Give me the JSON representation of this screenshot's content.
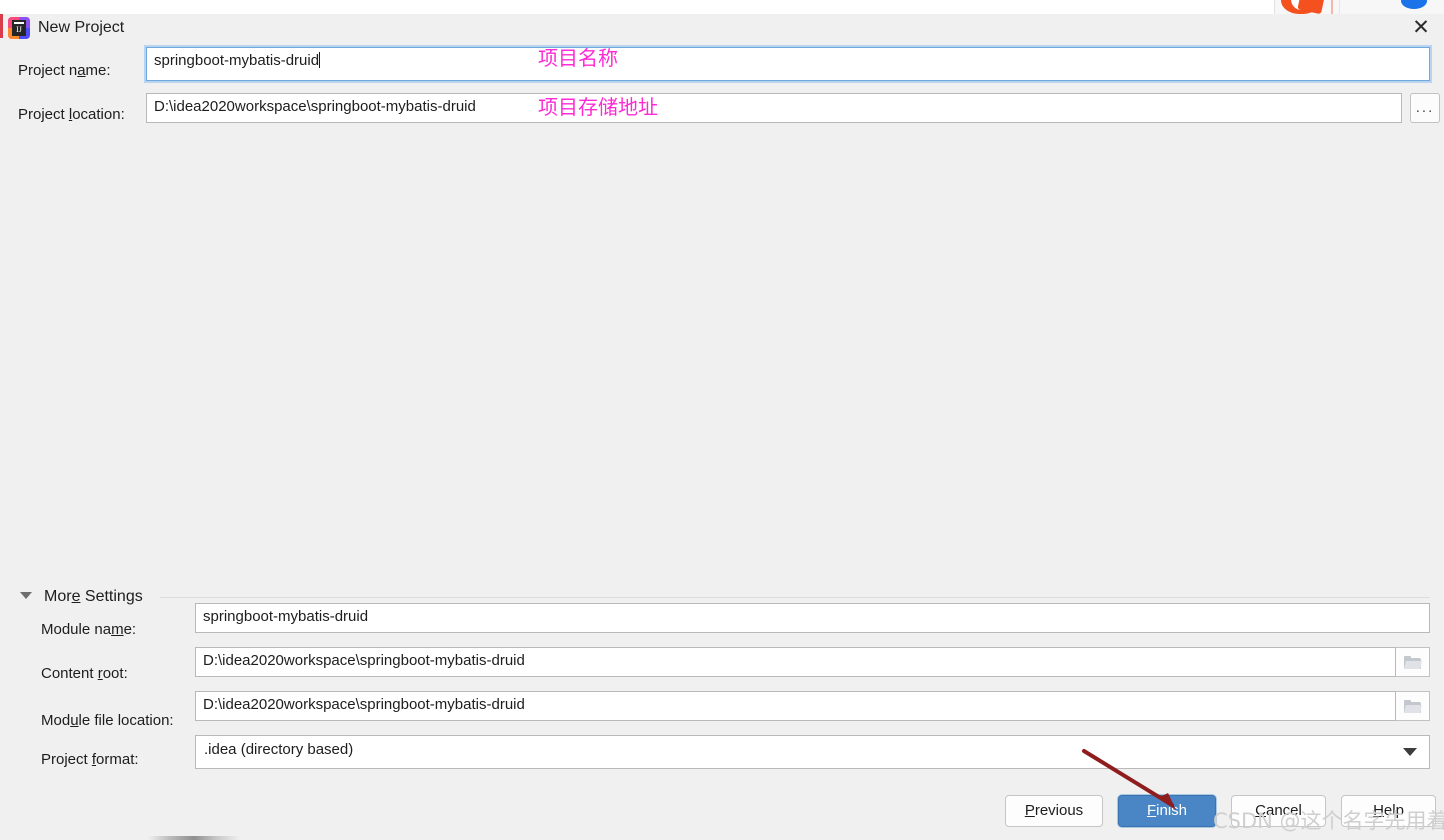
{
  "window": {
    "title": "New Project",
    "logo_icon": "intellij-idea-logo",
    "close_icon": "close-icon"
  },
  "background": {
    "orange_icon": "orange-browser-logo",
    "blue_icon": "blue-browser-dot"
  },
  "top_form": {
    "project_name": {
      "label_pre": "Project n",
      "label_mn": "a",
      "label_post": "me:",
      "value": "springboot-mybatis-druid",
      "focused": true
    },
    "project_location": {
      "label_pre": "Project ",
      "label_mn": "l",
      "label_post": "ocation:",
      "value": "D:\\idea2020workspace\\springboot-mybatis-druid",
      "browse_button": "...",
      "browse_icon": "ellipsis-icon"
    }
  },
  "annotations": {
    "project_name_note": "项目名称",
    "project_location_note": "项目存储地址",
    "finish_arrow": "red-arrow-pointing-to-finish",
    "arrow_color": "#8f1d1d",
    "note_color": "#ff2ad4"
  },
  "more_settings": {
    "title": "More Settings",
    "title_pre": "Mor",
    "title_mn": "e",
    "title_post": " Settings",
    "expanded": true,
    "collapse_icon": "chevron-down-icon",
    "fields": [
      {
        "label_pre": "Module na",
        "label_mn": "m",
        "label_post": "e:",
        "value": "springboot-mybatis-druid",
        "has_folder_button": false
      },
      {
        "label_pre": "Content ",
        "label_mn": "r",
        "label_post": "oot:",
        "value": "D:\\idea2020workspace\\springboot-mybatis-druid",
        "has_folder_button": true,
        "folder_icon": "folder-icon"
      },
      {
        "label_pre": "Mod",
        "label_mn": "u",
        "label_post": "le file location:",
        "value": "D:\\idea2020workspace\\springboot-mybatis-druid",
        "has_folder_button": true,
        "folder_icon": "folder-icon"
      }
    ],
    "project_format": {
      "label_pre": "Project ",
      "label_mn": "f",
      "label_post": "ormat:",
      "value": ".idea (directory based)",
      "dropdown_icon": "chevron-down-icon"
    }
  },
  "footer": {
    "previous": {
      "pre": "",
      "mn": "P",
      "post": "revious"
    },
    "finish": {
      "pre": "",
      "mn": "F",
      "post": "inish"
    },
    "cancel": {
      "pre": "",
      "mn": "C",
      "post": "ancel"
    },
    "help": {
      "pre": "",
      "mn": "H",
      "post": "elp"
    },
    "primary_color": "#4a86c5"
  },
  "watermark": {
    "text": "CSDN @这个名字先用着"
  }
}
